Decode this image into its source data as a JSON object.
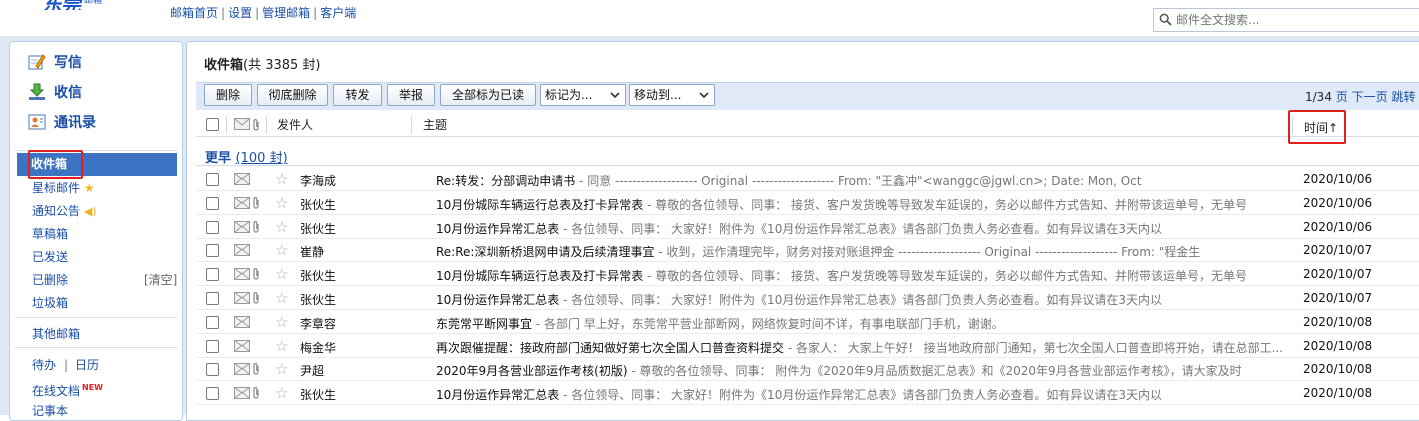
{
  "header": {
    "logo_text": "东莞",
    "logo_sub": "邮箱",
    "links": [
      "邮箱首页",
      "设置",
      "管理邮箱",
      "客户端"
    ],
    "search_placeholder": "邮件全文搜索..."
  },
  "sidebar": {
    "quick": [
      {
        "label": "写信",
        "icon": "compose-icon"
      },
      {
        "label": "收信",
        "icon": "receive-icon"
      },
      {
        "label": "通讯录",
        "icon": "contacts-icon"
      }
    ],
    "folders": {
      "inbox": "收件箱",
      "starred": "星标邮件",
      "notices": "通知公告",
      "drafts": "草稿箱",
      "sent": "已发送",
      "deleted": "已删除",
      "clear": "[清空]",
      "junk": "垃圾箱",
      "other": "其他邮箱",
      "todo": "待办",
      "calendar": "日历",
      "docs": "在线文档",
      "new_badge": "NEW",
      "notes": "记事本"
    }
  },
  "main": {
    "title": "收件箱",
    "count": "(共 3385 封)",
    "toolbar": {
      "delete": "删除",
      "purge": "彻底删除",
      "forward": "转发",
      "report": "举报",
      "mark_all_read": "全部标为已读",
      "mark_as": "标记为...",
      "move_to": "移动到..."
    },
    "pager": {
      "page": "1/34",
      "page_unit": "页",
      "next": "下一页",
      "jump": "跳转"
    },
    "columns": {
      "sender": "发件人",
      "subject": "主题",
      "time": "时间↑"
    },
    "group": {
      "label": "更早",
      "count": "(100 封)"
    },
    "accent": "#3d73c3",
    "highlight": "#e0201c",
    "rows": [
      {
        "sender": "李海成",
        "subject": "Re:转发：分部调动申请书",
        "preview": " - 同意 ------------------- Original ------------------- From: \"王鑫冲\"<wanggc@jgwl.cn>; Date: Mon, Oct",
        "date": "2020/10/06",
        "clip": false
      },
      {
        "sender": "张伙生",
        "subject": "10月份城际车辆运行总表及打卡异常表",
        "preview": " - 尊敬的各位领导、同事： 接货、客户发货晚等导致发车延误的，务必以邮件方式告知、并附带该运单号，无单号",
        "date": "2020/10/06",
        "clip": true
      },
      {
        "sender": "张伙生",
        "subject": "10月份运作异常汇总表",
        "preview": " - 各位领导、同事： 大家好！附件为《10月份运作异常汇总表》请各部门负责人务必查看。如有异议请在3天内以",
        "date": "2020/10/06",
        "clip": true
      },
      {
        "sender": "崔静",
        "subject": "Re:Re:深圳新桥退网申请及后续清理事宜",
        "preview": " - 收到，运作清理完毕，财务对接对账退押金 ------------------- Original ------------------- From: \"程金生",
        "date": "2020/10/07",
        "clip": false
      },
      {
        "sender": "张伙生",
        "subject": "10月份城际车辆运行总表及打卡异常表",
        "preview": " - 尊敬的各位领导、同事： 接货、客户发货晚等导致发车延误的，务必以邮件方式告知、并附带该运单号，无单号",
        "date": "2020/10/07",
        "clip": true
      },
      {
        "sender": "张伙生",
        "subject": "10月份运作异常汇总表",
        "preview": " - 各位领导、同事： 大家好！附件为《10月份运作异常汇总表》请各部门负责人务必查看。如有异议请在3天内以",
        "date": "2020/10/07",
        "clip": true
      },
      {
        "sender": "李章容",
        "subject": "东莞常平断网事宜",
        "preview": " - 各部门 早上好，东莞常平营业部断网，网络恢复时间不详，有事电联部门手机，谢谢。",
        "date": "2020/10/08",
        "clip": false
      },
      {
        "sender": "梅金华",
        "subject": "再次跟催提醒：接政府部门通知做好第七次全国人口普查资料提交",
        "preview": " - 各家人： 大家上午好！ 接当地政府部门通知，第七次全国人口普查即将开始，请在总部工...",
        "date": "2020/10/08",
        "clip": false
      },
      {
        "sender": "尹超",
        "subject": "2020年9月各营业部运作考核(初版)",
        "preview": " - 尊敬的各位领导、同事： 附件为《2020年9月品质数据汇总表》和《2020年9月各营业部运作考核》，请大家及时",
        "date": "2020/10/08",
        "clip": true
      },
      {
        "sender": "张伙生",
        "subject": "10月份运作异常汇总表",
        "preview": " - 各位领导、同事： 大家好！附件为《10月份运作异常汇总表》请各部门负责人务必查看。如有异议请在3天内以",
        "date": "2020/10/08",
        "clip": true
      }
    ]
  }
}
